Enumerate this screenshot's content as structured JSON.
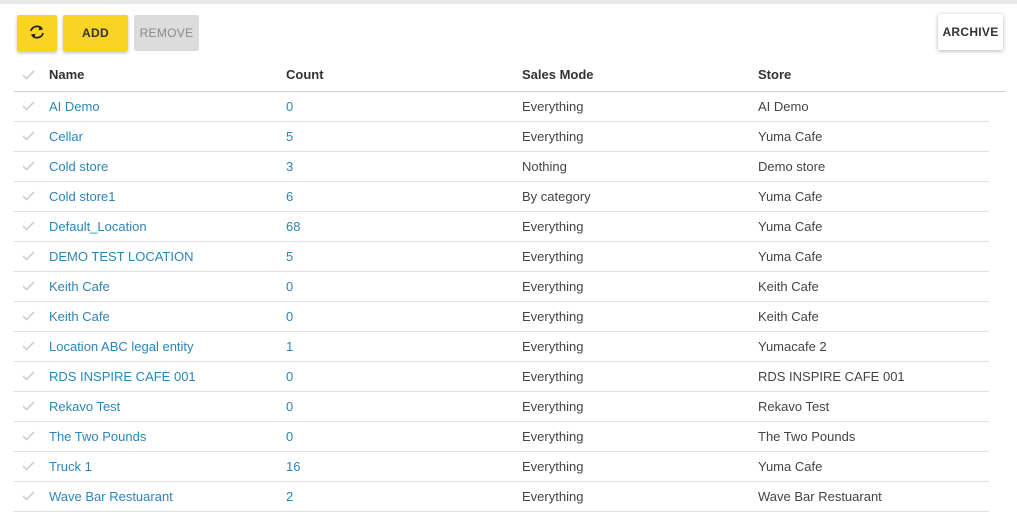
{
  "toolbar": {
    "refresh_icon": "refresh-icon",
    "add_label": "ADD",
    "remove_label": "REMOVE",
    "archive_label": "ARCHIVE",
    "accent_color": "#f9d423"
  },
  "table": {
    "columns": [
      "Name",
      "Count",
      "Sales Mode",
      "Store"
    ],
    "rows": [
      {
        "name": "AI Demo",
        "count": "0",
        "mode": "Everything",
        "store": "AI Demo"
      },
      {
        "name": "Cellar",
        "count": "5",
        "mode": "Everything",
        "store": "Yuma Cafe"
      },
      {
        "name": "Cold store",
        "count": "3",
        "mode": "Nothing",
        "store": "Demo store"
      },
      {
        "name": "Cold store1",
        "count": "6",
        "mode": "By category",
        "store": "Yuma Cafe"
      },
      {
        "name": "Default_Location",
        "count": "68",
        "mode": "Everything",
        "store": "Yuma Cafe"
      },
      {
        "name": "DEMO TEST LOCATION",
        "count": "5",
        "mode": "Everything",
        "store": "Yuma Cafe"
      },
      {
        "name": "Keith Cafe",
        "count": "0",
        "mode": "Everything",
        "store": "Keith Cafe"
      },
      {
        "name": "Keith Cafe",
        "count": "0",
        "mode": "Everything",
        "store": "Keith Cafe"
      },
      {
        "name": "Location ABC legal entity",
        "count": "1",
        "mode": "Everything",
        "store": "Yumacafe 2"
      },
      {
        "name": "RDS INSPIRE CAFE 001",
        "count": "0",
        "mode": "Everything",
        "store": "RDS INSPIRE CAFE 001"
      },
      {
        "name": "Rekavo Test",
        "count": "0",
        "mode": "Everything",
        "store": "Rekavo Test"
      },
      {
        "name": "The Two Pounds",
        "count": "0",
        "mode": "Everything",
        "store": "The Two Pounds"
      },
      {
        "name": "Truck 1",
        "count": "16",
        "mode": "Everything",
        "store": "Yuma Cafe"
      },
      {
        "name": "Wave Bar Restuarant",
        "count": "2",
        "mode": "Everything",
        "store": "Wave Bar Restuarant"
      }
    ]
  }
}
